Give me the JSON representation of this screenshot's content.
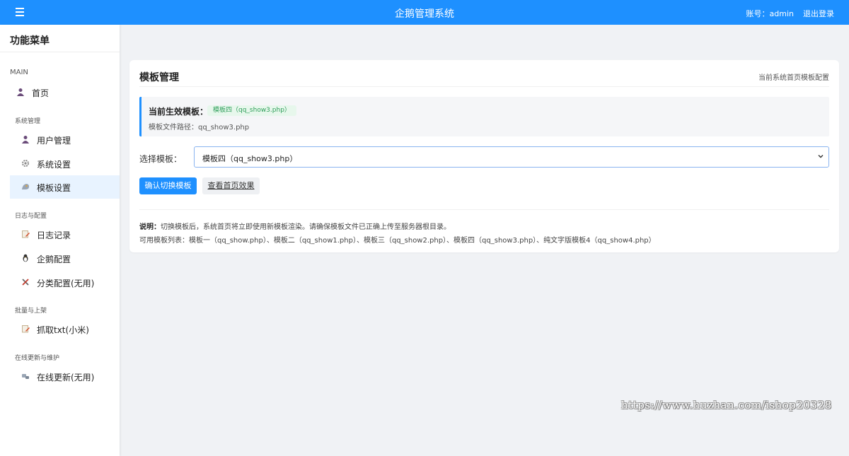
{
  "header": {
    "app_title": "企鹅管理系统",
    "account": "账号：admin",
    "logout": "退出登录"
  },
  "sidebar": {
    "title": "功能菜单",
    "sections": {
      "main": "MAIN",
      "system": "系统管理",
      "logs": "日志与配置",
      "batch": "批量与上架",
      "update": "在线更新与维护"
    },
    "items": {
      "home": "首页",
      "users": "用户管理",
      "settings": "系统设置",
      "templates": "模板设置",
      "log_records": "日志记录",
      "penguin_config": "企鹅配置",
      "category_config": "分类配置(无用)",
      "fetch_txt": "抓取txt(小米)",
      "online_update": "在线更新(无用)"
    },
    "active_item": "模板设置"
  },
  "card": {
    "title": "模板管理",
    "subtitle": "当前系统首页模板配置",
    "current_label": "当前生效模板：",
    "current_badge": "模板四（qq_show3.php）",
    "current_path": "模板文件路径：qq_show3.php",
    "select_label": "选择模板：",
    "select_value": "模板四（qq_show3.php）",
    "confirm_button": "确认切换模板",
    "preview_button": "查看首页效果",
    "note_label": "说明：",
    "note_text": "切换模板后，系统首页将立即使用新模板渲染。请确保模板文件已正确上传至服务器根目录。",
    "template_list": "可用模板列表：模板一（qq_show.php）、模板二（qq_show1.php）、模板三（qq_show2.php）、模板四（qq_show3.php）、纯文字版模板4（qq_show4.php）"
  },
  "watermark": "https://www.huzhan.com/ishop20328",
  "colors": {
    "accent": "#1e90ff",
    "active_bg": "#e8f3ff",
    "badge_bg": "#e7f7ec",
    "badge_text": "#2f9e5a"
  }
}
